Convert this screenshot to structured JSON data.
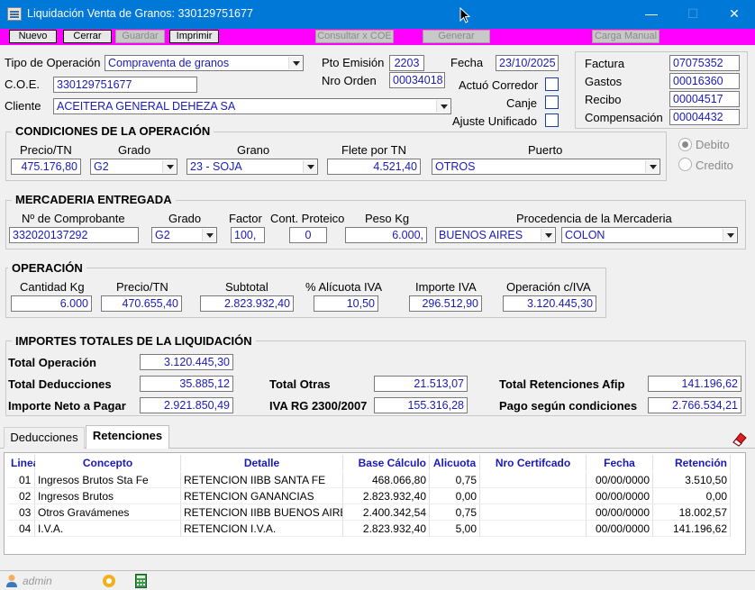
{
  "window": {
    "title": "Liquidación Venta de Granos: 330129751677",
    "minimize": "—",
    "maximize": "☐",
    "close": "✕"
  },
  "toolbar": {
    "nuevo": "Nuevo",
    "cerrar": "Cerrar",
    "guardar": "Guardar",
    "imprimir": "Imprimir",
    "consultar": "Consultar x COE",
    "generar": "Generar",
    "carga": "Carga Manual"
  },
  "header": {
    "tipo_label": "Tipo de Operación",
    "tipo_value": "Compraventa de granos",
    "coe_label": "C.O.E.",
    "coe_value": "330129751677",
    "cliente_label": "Cliente",
    "cliente_value": "ACEITERA GENERAL DEHEZA SA",
    "pto_label": "Pto Emisión",
    "pto_value": "2203",
    "nro_label": "Nro Orden",
    "nro_value": "00034018",
    "fecha_label": "Fecha",
    "fecha_value": "23/10/2025",
    "corredor_label": "Actuó Corredor",
    "canje_label": "Canje",
    "ajuste_label": "Ajuste Unificado"
  },
  "docs": {
    "factura_label": "Factura",
    "factura_value": "07075352",
    "gastos_label": "Gastos",
    "gastos_value": "00016360",
    "recibo_label": "Recibo",
    "recibo_value": "00004517",
    "comp_label": "Compensación",
    "comp_value": "00004432"
  },
  "condiciones": {
    "title": "CONDICIONES DE LA OPERACIÓN",
    "precio_label": "Precio/TN",
    "precio_value": "475.176,80",
    "grado_label": "Grado",
    "grado_value": "G2",
    "grano_label": "Grano",
    "grano_value": "23 - SOJA",
    "flete_label": "Flete por TN",
    "flete_value": "4.521,40",
    "puerto_label": "Puerto",
    "puerto_value": "OTROS",
    "debito": "Debito",
    "credito": "Credito"
  },
  "mercaderia": {
    "title": "MERCADERIA ENTREGADA",
    "comp_label": "Nº de Comprobante",
    "comp_value": "332020137292",
    "grado_label": "Grado",
    "grado_value": "G2",
    "factor_label": "Factor",
    "factor_value": "100,",
    "proteico_label": "Cont. Proteico",
    "proteico_value": "0",
    "peso_label": "Peso Kg",
    "peso_value": "6.000,",
    "proc_label": "Procedencia de la Mercaderia",
    "prov_value": "BUENOS AIRES",
    "loc_value": "COLON"
  },
  "operacion": {
    "title": "OPERACIÓN",
    "cant_label": "Cantidad Kg",
    "cant_value": "6.000",
    "precio_label": "Precio/TN",
    "precio_value": "470.655,40",
    "sub_label": "Subtotal",
    "sub_value": "2.823.932,40",
    "aliq_label": "% Alícuota IVA",
    "aliq_value": "10,50",
    "iva_label": "Importe IVA",
    "iva_value": "296.512,90",
    "opiva_label": "Operación c/IVA",
    "opiva_value": "3.120.445,30"
  },
  "importes": {
    "title": "IMPORTES TOTALES DE LA LIQUIDACIÓN",
    "total_op_label": "Total Operación",
    "total_op_value": "3.120.445,30",
    "total_ded_label": "Total Deducciones",
    "total_ded_value": "35.885,12",
    "neto_label": "Importe Neto a Pagar",
    "neto_value": "2.921.850,49",
    "otras_label": "Total Otras",
    "otras_value": "21.513,07",
    "ivarg_label": "IVA RG 2300/2007",
    "ivarg_value": "155.316,28",
    "ret_label": "Total Retenciones Afip",
    "ret_value": "141.196,62",
    "pago_label": "Pago según condiciones",
    "pago_value": "2.766.534,21"
  },
  "tabs": {
    "deducciones": "Deducciones",
    "retenciones": "Retenciones"
  },
  "table": {
    "headers": [
      "Linea",
      "Concepto",
      "Detalle",
      "Base Cálculo",
      "Alicuota",
      "Nro Certifcado",
      "Fecha",
      "Retención"
    ],
    "rows": [
      [
        "01",
        "Ingresos Brutos Sta Fe",
        "RETENCION IIBB SANTA FE",
        "468.066,80",
        "0,75",
        "",
        "00/00/0000",
        "3.510,50"
      ],
      [
        "02",
        "Ingresos Brutos",
        "RETENCION GANANCIAS",
        "2.823.932,40",
        "0,00",
        "",
        "00/00/0000",
        "0,00"
      ],
      [
        "03",
        "Otros Gravámenes",
        "RETENCION IIBB BUENOS AIRE",
        "2.400.342,54",
        "0,75",
        "",
        "00/00/0000",
        "18.002,57"
      ],
      [
        "04",
        "I.V.A.",
        "RETENCION I.V.A.",
        "2.823.932,40",
        "5,00",
        "",
        "00/00/0000",
        "141.196,62"
      ]
    ]
  },
  "status": {
    "user": "admin"
  },
  "icons": {
    "app": "grain-sale-icon",
    "eraser": "eraser-icon",
    "user": "user-icon",
    "gear": "gear-icon",
    "calculator": "calculator-icon"
  },
  "colors": {
    "titlebar": "#0078d7",
    "toolbar": "#ff00ff",
    "value_text": "#1a1ab8"
  }
}
